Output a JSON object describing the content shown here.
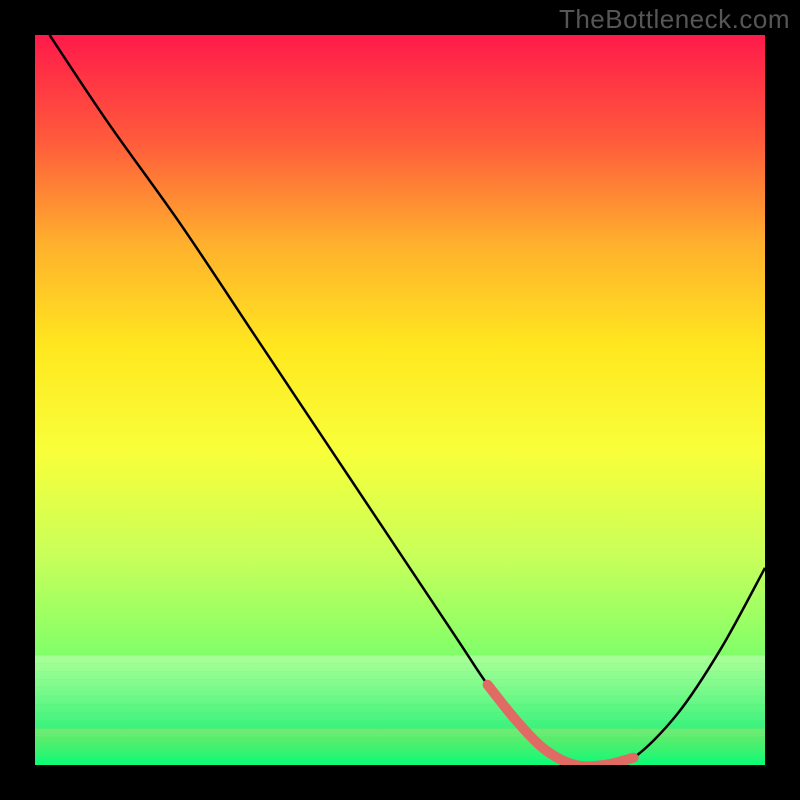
{
  "watermark": "TheBottleneck.com",
  "chart_data": {
    "type": "line",
    "title": "",
    "xlabel": "",
    "ylabel": "",
    "xlim": [
      0,
      100
    ],
    "ylim": [
      0,
      100
    ],
    "grid": false,
    "gradient_colors": [
      "#ff1a4a",
      "#ff5a3c",
      "#ffb02d",
      "#ffe81f",
      "#f8ff3a",
      "#c8ff5a",
      "#7dff6a",
      "#00e97a"
    ],
    "series": [
      {
        "name": "bottleneck-curve",
        "stroke": "#000000",
        "x": [
          2,
          10,
          20,
          30,
          40,
          50,
          58,
          62,
          66,
          70,
          74,
          78,
          82,
          88,
          94,
          100
        ],
        "y": [
          100,
          88,
          74,
          59,
          44,
          29,
          17,
          11,
          6,
          2,
          0,
          0,
          1,
          7,
          16,
          27
        ]
      }
    ],
    "highlight": {
      "name": "optimal-region",
      "stroke": "#e06a64",
      "x": [
        62,
        66,
        70,
        74,
        78,
        82
      ],
      "y": [
        11,
        6,
        2,
        0,
        0,
        1
      ]
    },
    "green_band": {
      "y0": 0,
      "y1": 5
    },
    "pale_band": {
      "y0": 5,
      "y1": 15
    }
  }
}
